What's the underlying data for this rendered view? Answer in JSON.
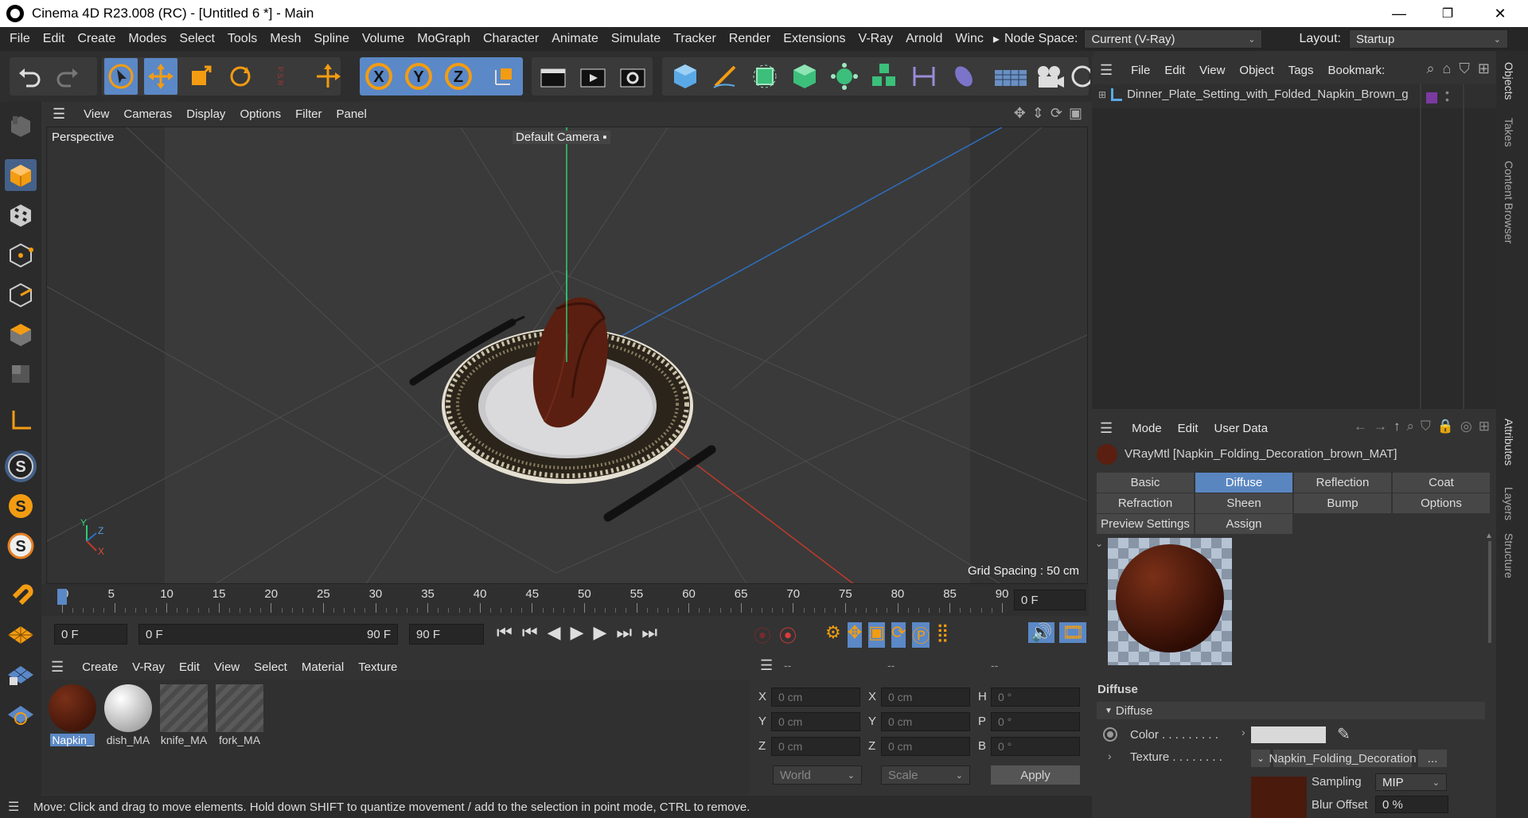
{
  "window": {
    "title": "Cinema 4D R23.008 (RC) - [Untitled 6 *] - Main",
    "minimize": "—",
    "restore": "❐",
    "close": "✕"
  },
  "menubar": {
    "items": [
      "File",
      "Edit",
      "Create",
      "Modes",
      "Select",
      "Tools",
      "Mesh",
      "Spline",
      "Volume",
      "MoGraph",
      "Character",
      "Animate",
      "Simulate",
      "Tracker",
      "Render",
      "Extensions",
      "V-Ray",
      "Arnold",
      "Winc"
    ],
    "more": "▸",
    "node_space_label": "Node Space:",
    "node_space_value": "Current (V-Ray)",
    "layout_label": "Layout:",
    "layout_value": "Startup"
  },
  "toolbar": {
    "icons": [
      "undo-icon",
      "redo-icon",
      "select-arrow-icon",
      "move-icon",
      "scale-icon",
      "rotate-icon",
      "psr-lock-icon",
      "transform-icon",
      "x-axis-icon",
      "y-axis-icon",
      "z-axis-icon",
      "coordinate-system-icon",
      "render-region-icon",
      "render-view-icon",
      "render-settings-icon",
      "cube-primitive-icon",
      "pen-spline-icon",
      "subdivision-icon",
      "extrude-icon",
      "cloner-icon",
      "mograph-icon",
      "symmetry-icon",
      "deformer-icon",
      "floor-icon",
      "camera-icon",
      "light-icon"
    ],
    "axis_labels": [
      "X",
      "Y",
      "Z"
    ],
    "psr_label": "P S R"
  },
  "leftbar": {
    "icons": [
      "make-editable-icon",
      "model-mode-icon",
      "texture-mode-icon",
      "point-mode-icon",
      "edge-mode-icon",
      "polygon-mode-icon",
      "uv-mode-icon",
      "axis-mode-icon",
      "snap-s-icon",
      "snap-s2-icon",
      "snap-s3-icon",
      "magnet-icon",
      "workplane-icon",
      "workplane-lock-icon",
      "workplane-align-icon"
    ],
    "snap_letter": "S"
  },
  "viewport": {
    "menu": [
      "View",
      "Cameras",
      "Display",
      "Options",
      "Filter",
      "Panel"
    ],
    "label": "Perspective",
    "camera": "Default Camera",
    "grid_spacing": "Grid Spacing : 50 cm",
    "axis_x": "X",
    "axis_y": "Y",
    "axis_z": "Z",
    "colors": {
      "bg": "#3c3c3c",
      "x_axis": "#c0392b",
      "y_axis": "#2ecc71",
      "z_axis": "#2f6fc0"
    }
  },
  "timeline": {
    "ticks": [
      "0",
      "5",
      "10",
      "15",
      "20",
      "25",
      "30",
      "35",
      "40",
      "45",
      "50",
      "55",
      "60",
      "65",
      "70",
      "75",
      "80",
      "85",
      "90"
    ],
    "current_frame": "0 F",
    "start_frame": "0 F",
    "range_start": "0 F",
    "range_end": "90 F",
    "end_frame": "90 F"
  },
  "material_manager": {
    "menu": [
      "Create",
      "V-Ray",
      "Edit",
      "View",
      "Select",
      "Material",
      "Texture"
    ],
    "materials": [
      {
        "name": "Napkin_",
        "kind": "brown"
      },
      {
        "name": "dish_MA",
        "kind": "white"
      },
      {
        "name": "knife_MA",
        "kind": "striped"
      },
      {
        "name": "fork_MA",
        "kind": "striped"
      }
    ]
  },
  "coordinates": {
    "headers": [
      "--",
      "--",
      "--"
    ],
    "rows": [
      {
        "l1": "X",
        "v1": "0 cm",
        "l2": "X",
        "v2": "0 cm",
        "l3": "H",
        "v3": "0 °"
      },
      {
        "l1": "Y",
        "v1": "0 cm",
        "l2": "Y",
        "v2": "0 cm",
        "l3": "P",
        "v3": "0 °"
      },
      {
        "l1": "Z",
        "v1": "0 cm",
        "l2": "Z",
        "v2": "0 cm",
        "l3": "B",
        "v3": "0 °"
      }
    ],
    "space": "World",
    "mode": "Scale",
    "apply": "Apply"
  },
  "object_manager": {
    "menu": [
      "File",
      "Edit",
      "View",
      "Object",
      "Tags",
      "Bookmark:"
    ],
    "objects": [
      {
        "name": "Dinner_Plate_Setting_with_Folded_Napkin_Brown_g"
      }
    ]
  },
  "attributes": {
    "menu": [
      "Mode",
      "Edit",
      "User Data"
    ],
    "material_title": "VRayMtl [Napkin_Folding_Decoration_brown_MAT]",
    "tabs_row1": [
      "Basic",
      "Diffuse",
      "Reflection",
      "Coat"
    ],
    "tabs_row2": [
      "Refraction",
      "Sheen",
      "Bump",
      "Options"
    ],
    "tabs_row3": [
      "Preview Settings",
      "Assign"
    ],
    "active_tab": "Diffuse",
    "section_title": "Diffuse",
    "group_title": "Diffuse",
    "color_label": "Color . . . . . . . . .",
    "texture_label": "Texture . . . . . . . .",
    "texture_value": "Napkin_Folding_Decoration",
    "texture_more": "...",
    "sampling_label": "Sampling",
    "sampling_value": "MIP",
    "blur_label": "Blur Offset",
    "blur_value": "0 %",
    "colors": {
      "swatch": "#d9d9d9",
      "napkin": "#5a1f10"
    }
  },
  "right_tabs": [
    "Objects",
    "Takes",
    "Content Browser",
    "Attributes",
    "Layers",
    "Structure"
  ],
  "status": "Move: Click and drag to move elements. Hold down SHIFT to quantize movement / add to the selection in point mode, CTRL to remove."
}
